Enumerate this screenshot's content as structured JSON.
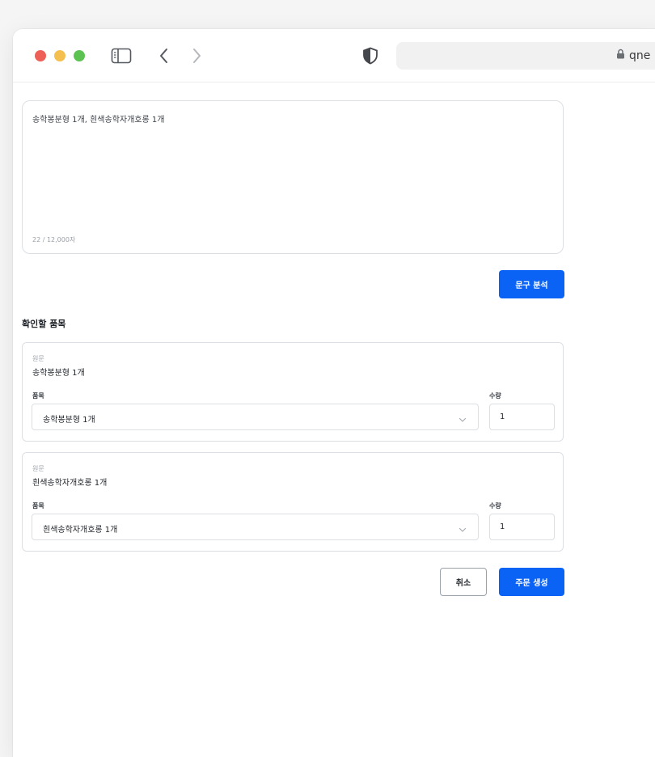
{
  "browser": {
    "url_text": "qne",
    "lock_icon": "lock-icon",
    "colors": {
      "close": "#ee5f57",
      "minimize": "#f4bf4f",
      "maximize": "#5cc352"
    }
  },
  "input": {
    "text": "송학봉분형 1개, 흰색송학자개호롱 1개",
    "char_count": "22 / 12,000자"
  },
  "analyze_button": "문구 분석",
  "section_title": "확인할 품목",
  "items": [
    {
      "original_label": "원문",
      "original_text": "송학봉분형 1개",
      "item_label": "품목",
      "item_value": "송학봉분형 1개",
      "qty_label": "수량",
      "qty_value": "1"
    },
    {
      "original_label": "원문",
      "original_text": "흰색송학자개호롱 1개",
      "item_label": "품목",
      "item_value": "흰색송학자개호롱 1개",
      "qty_label": "수량",
      "qty_value": "1"
    }
  ],
  "actions": {
    "cancel": "취소",
    "create_order": "주문 생성"
  },
  "accent_color": "#0b63f6"
}
